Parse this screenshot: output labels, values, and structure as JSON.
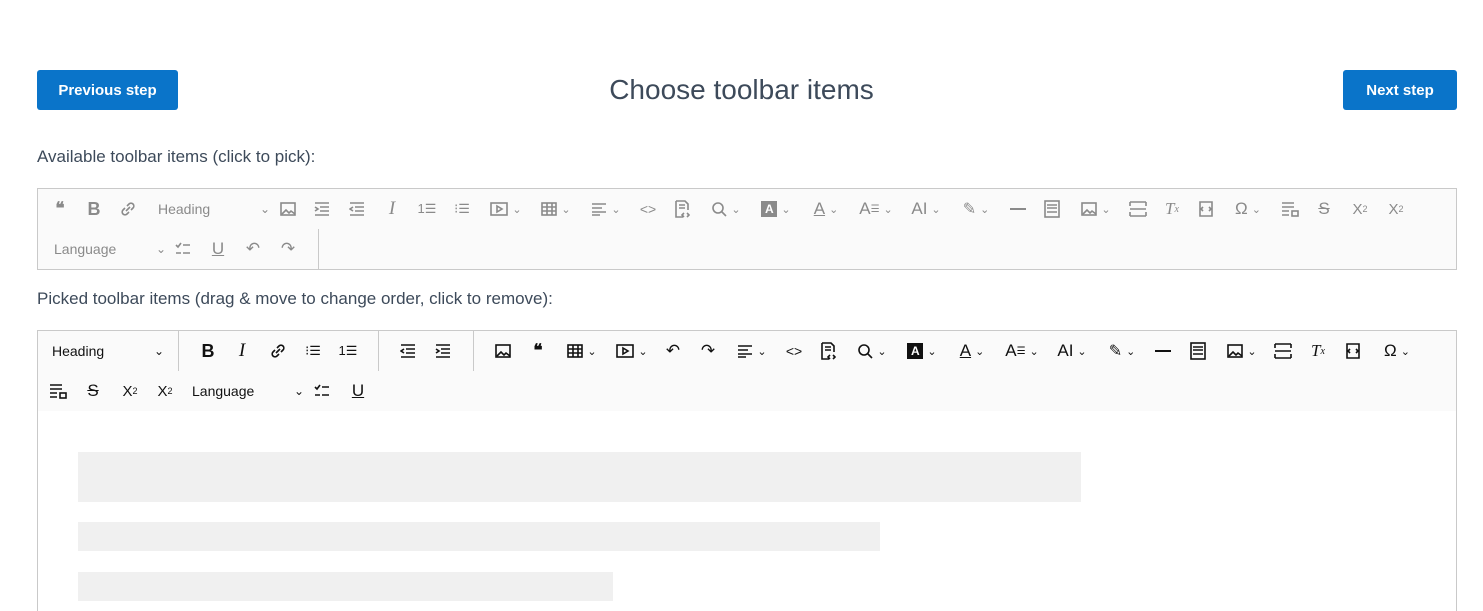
{
  "header": {
    "prev_label": "Previous step",
    "title": "Choose toolbar items",
    "next_label": "Next step"
  },
  "available": {
    "label": "Available toolbar items (click to pick):",
    "heading_dropdown": "Heading",
    "language_dropdown": "Language",
    "items": [
      "blockquote",
      "bold",
      "link",
      "heading",
      "image",
      "indent",
      "outdent",
      "italic",
      "numbered-list",
      "bulleted-list",
      "media-embed",
      "table",
      "alignment",
      "code",
      "source-editing",
      "find-replace",
      "font-background-color",
      "font-color",
      "font-family",
      "font-size",
      "highlight",
      "horizontal-line",
      "html-embed",
      "insert-image",
      "page-break",
      "remove-format",
      "show-blocks",
      "special-characters",
      "restricted-editing",
      "strikethrough",
      "subscript",
      "superscript",
      "code-block",
      "todo-list",
      "underline",
      "undo",
      "redo"
    ]
  },
  "picked": {
    "label": "Picked toolbar items (drag & move to change order, click to remove):",
    "heading_dropdown": "Heading",
    "language_dropdown": "Language",
    "items": [
      "heading",
      "bold",
      "italic",
      "link",
      "bulleted-list",
      "numbered-list",
      "outdent",
      "indent",
      "image",
      "blockquote",
      "table",
      "media-embed",
      "undo",
      "redo",
      "alignment",
      "code",
      "source-editing",
      "find-replace",
      "font-background-color",
      "font-color",
      "font-family",
      "font-size",
      "highlight",
      "horizontal-line",
      "html-embed",
      "insert-image",
      "page-break",
      "remove-format",
      "show-blocks",
      "special-characters",
      "restricted-editing",
      "strikethrough",
      "subscript",
      "superscript",
      "code-block",
      "todo-list",
      "underline"
    ]
  },
  "colors": {
    "accent": "#0a74c9",
    "title": "#3d4a5a",
    "toolbar_bg": "#fafafa",
    "placeholder": "#f0f0f0"
  }
}
